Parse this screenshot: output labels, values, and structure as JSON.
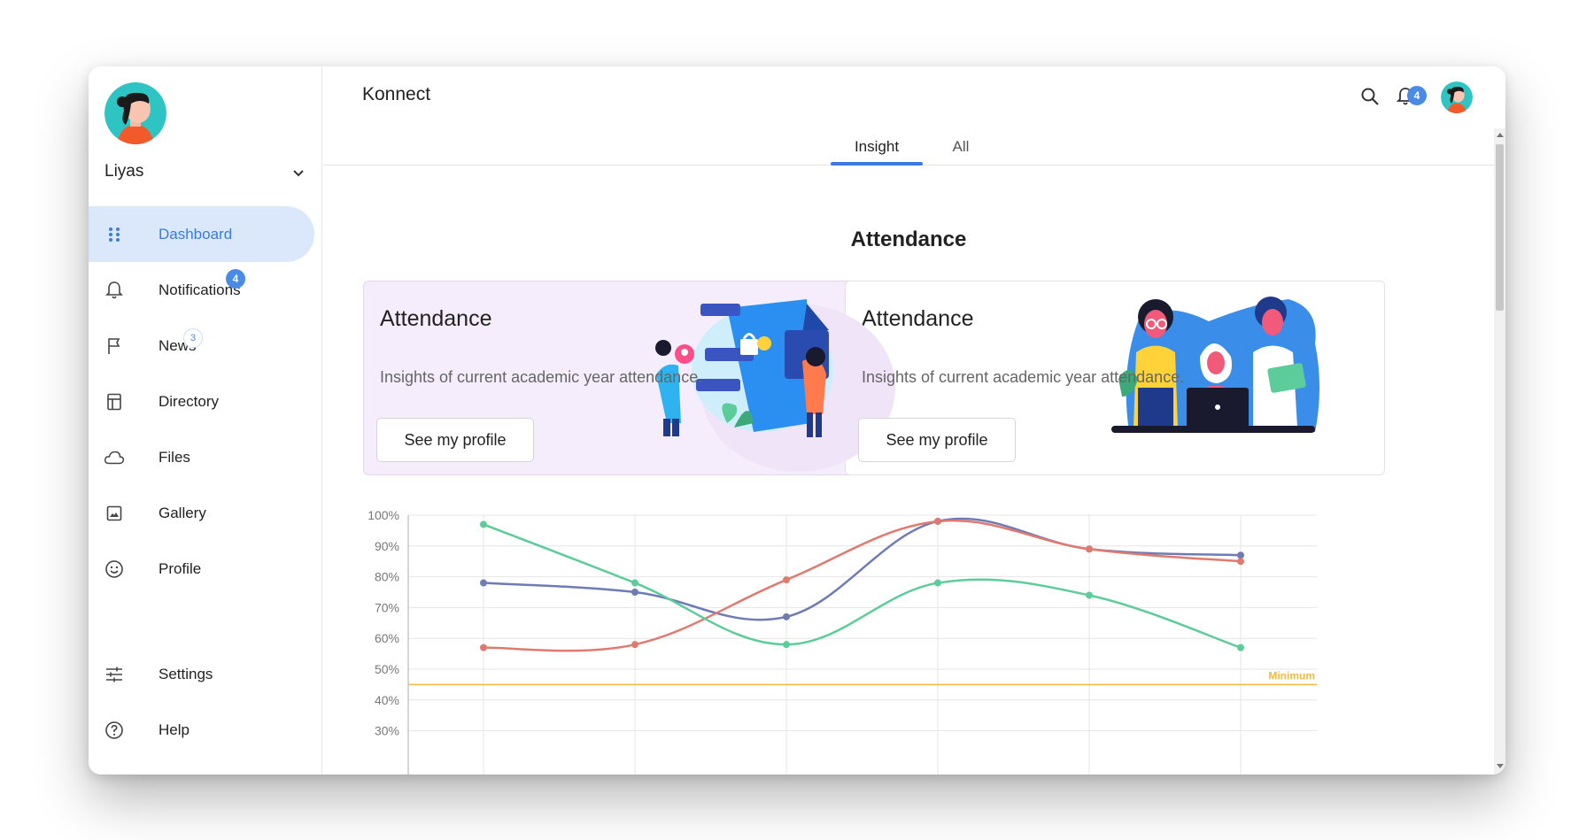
{
  "app": {
    "title": "Konnect"
  },
  "user": {
    "name": "Liyas"
  },
  "sidebar": {
    "items": [
      {
        "label": "Dashboard",
        "icon": "dots-grid-icon",
        "active": true
      },
      {
        "label": "Notifications",
        "icon": "bell-icon",
        "badge": "4"
      },
      {
        "label": "News",
        "icon": "flag-icon",
        "badge": "3"
      },
      {
        "label": "Directory",
        "icon": "directory-icon"
      },
      {
        "label": "Files",
        "icon": "cloud-icon"
      },
      {
        "label": "Gallery",
        "icon": "image-icon"
      },
      {
        "label": "Profile",
        "icon": "smiley-icon"
      }
    ],
    "bottom_items": [
      {
        "label": "Settings",
        "icon": "sliders-icon"
      },
      {
        "label": "Help",
        "icon": "help-icon"
      }
    ]
  },
  "header": {
    "notification_count": "4"
  },
  "tabs": [
    {
      "label": "Insight",
      "active": true
    },
    {
      "label": "All",
      "active": false
    }
  ],
  "section": {
    "title": "Attendance"
  },
  "cards": [
    {
      "title": "Attendance",
      "description": "Insights of current academic year attendance.",
      "button": "See my profile"
    },
    {
      "title": "Attendance",
      "description": "Insights of current academic year attendance.",
      "button": "See my profile"
    }
  ],
  "colors": {
    "accent": "#3a7be0",
    "active_bg": "#dbe8fb",
    "badge": "#4a8be8",
    "series_blue": "#6f7bb5",
    "series_red": "#e07a6e",
    "series_green": "#5ccc9a",
    "minimum_line": "#f5b942"
  },
  "chart_data": {
    "type": "line",
    "title": "",
    "xlabel": "",
    "ylabel": "",
    "y_ticks": [
      "100%",
      "90%",
      "80%",
      "70%",
      "60%",
      "50%",
      "40%",
      "30%"
    ],
    "ylim": [
      30,
      100
    ],
    "x_count": 6,
    "grid": true,
    "series": [
      {
        "values": [
          78,
          75,
          67,
          98,
          89,
          87
        ],
        "color": "#6f7bb5"
      },
      {
        "values": [
          57,
          58,
          79,
          98,
          89,
          85
        ],
        "color": "#e07a6e"
      },
      {
        "values": [
          97,
          78,
          58,
          78,
          74,
          57
        ],
        "color": "#5ccc9a"
      }
    ],
    "threshold": {
      "label": "Minimum",
      "value": 45,
      "color": "#f5b942"
    }
  }
}
